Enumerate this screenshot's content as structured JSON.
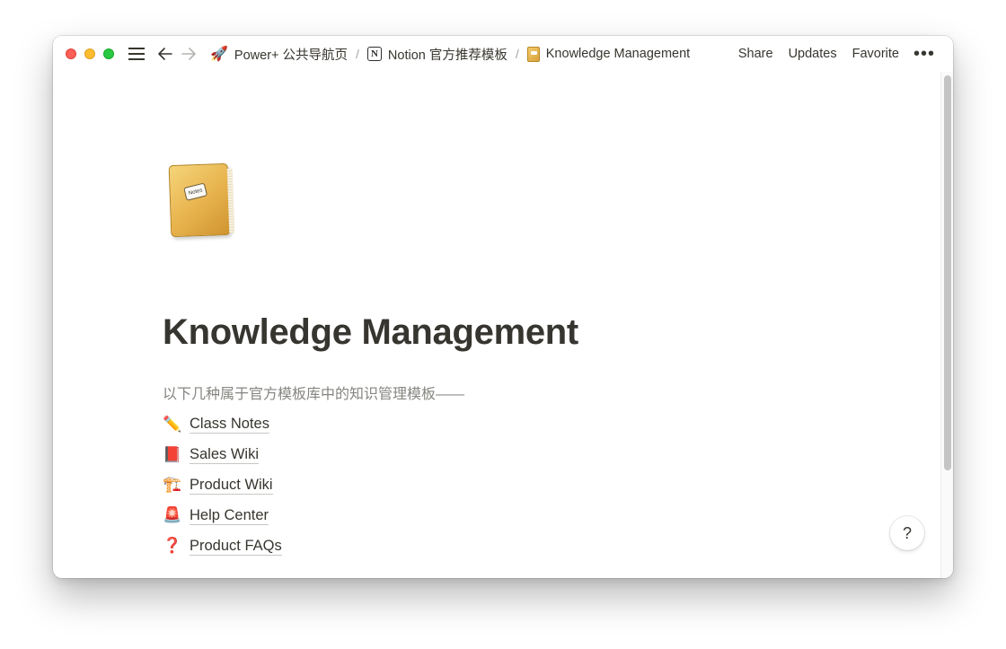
{
  "titlebar": {
    "menu_icon": "hamburger-icon",
    "back_icon": "arrow-left-icon",
    "forward_icon": "arrow-right-icon"
  },
  "breadcrumb": {
    "items": [
      {
        "icon": "rocket-icon",
        "label": "Power+ 公共导航页"
      },
      {
        "icon": "notion-logo-icon",
        "label": "Notion 官方推荐模板"
      },
      {
        "icon": "notebook-icon",
        "label": "Knowledge Management"
      }
    ],
    "separator": "/"
  },
  "top_actions": {
    "share": "Share",
    "updates": "Updates",
    "favorite": "Favorite",
    "more": "•••"
  },
  "page": {
    "icon": "notebook-icon",
    "icon_label": "Notes",
    "title": "Knowledge Management",
    "intro": "以下几种属于官方模板库中的知识管理模板——",
    "links": [
      {
        "emoji": "✏️",
        "icon": "pencil-icon",
        "label": "Class Notes"
      },
      {
        "emoji": "📕",
        "icon": "red-book-icon",
        "label": "Sales Wiki"
      },
      {
        "emoji": "🏗️",
        "icon": "crane-icon",
        "label": "Product Wiki"
      },
      {
        "emoji": "🚨",
        "icon": "siren-icon",
        "label": "Help Center"
      },
      {
        "emoji": "❓",
        "icon": "question-mark-icon",
        "label": "Product FAQs"
      }
    ]
  },
  "help": {
    "label": "?"
  }
}
